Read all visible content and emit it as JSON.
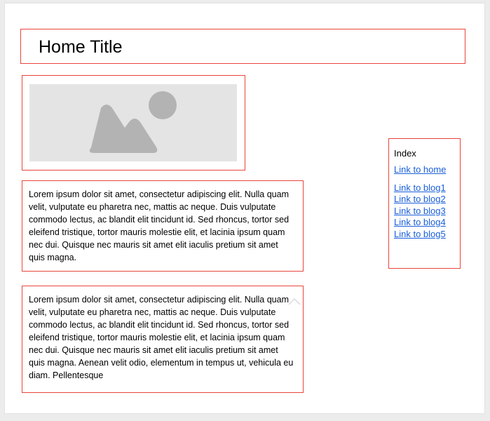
{
  "header": {
    "title": "Home Title"
  },
  "hero_image": {
    "icon": "image-placeholder-icon"
  },
  "content": {
    "paragraph_1": "Lorem ipsum dolor sit amet, consectetur adipiscing elit. Nulla quam velit, vulputate eu pharetra nec, mattis ac neque. Duis vulputate commodo lectus, ac blandit elit tincidunt id. Sed rhoncus, tortor sed eleifend tristique, tortor mauris molestie elit, et lacinia ipsum quam nec dui. Quisque nec mauris sit amet elit iaculis pretium sit amet quis magna.",
    "paragraph_2": "Lorem ipsum dolor sit amet, consectetur adipiscing elit. Nulla quam velit, vulputate eu pharetra nec, mattis ac neque. Duis vulputate commodo lectus, ac blandit elit tincidunt id. Sed rhoncus, tortor sed eleifend tristique, tortor mauris molestie elit, et lacinia ipsum quam nec dui. Quisque nec mauris sit amet elit iaculis pretium sit amet quis magna. Aenean velit odio, elementum in tempus ut, vehicula eu diam. Pellentesque"
  },
  "sidebar": {
    "heading": "Index",
    "links": [
      {
        "label": "Link to home"
      },
      {
        "label": "Link to blog1"
      },
      {
        "label": "Link to blog2"
      },
      {
        "label": "Link to blog3"
      },
      {
        "label": "Link to blog4"
      },
      {
        "label": "Link to blog5"
      }
    ]
  },
  "colors": {
    "border_accent": "#e8453c",
    "link": "#1a5fd9",
    "placeholder_bg": "#e4e4e4",
    "placeholder_shape": "#b3b3b3"
  }
}
